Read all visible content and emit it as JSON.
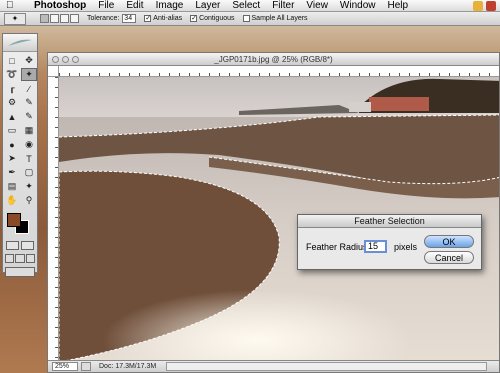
{
  "menubar": {
    "app": "Photoshop",
    "items": [
      "File",
      "Edit",
      "Image",
      "Layer",
      "Select",
      "Filter",
      "View",
      "Window",
      "Help"
    ]
  },
  "options_bar": {
    "tolerance_label": "Tolerance:",
    "tolerance_value": "34",
    "anti_alias_label": "Anti-alias",
    "contiguous_label": "Contiguous",
    "sample_all_label": "Sample All Layers"
  },
  "document": {
    "title": "_JGP0171b.jpg @ 25% (RGB/8*)",
    "zoom": "25%",
    "doc_size": "Doc: 17.3M/17.3M"
  },
  "dialog": {
    "title": "Feather Selection",
    "radius_label": "Feather Radius:",
    "radius_value": "15",
    "unit": "pixels",
    "ok_label": "OK",
    "cancel_label": "Cancel"
  },
  "colors": {
    "foreground": "#8a4a26",
    "background": "#000000",
    "ok_button": "#6aa3e8"
  }
}
